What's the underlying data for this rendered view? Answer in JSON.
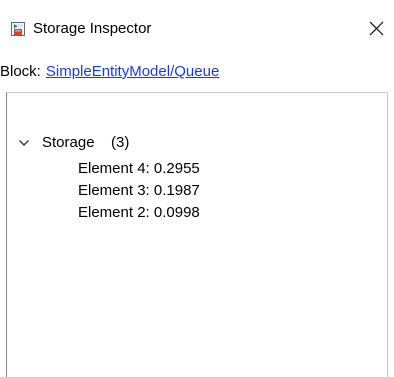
{
  "window": {
    "title": "Storage Inspector",
    "icon": "storage-inspector-app-icon",
    "close_icon": "close-icon"
  },
  "block": {
    "label": "Block:",
    "path": "SimpleEntityModel/Queue"
  },
  "tree": {
    "storage": {
      "label": "Storage",
      "count": "(3)",
      "expanded": true,
      "icon": "chevron-down-icon",
      "elements": [
        {
          "text": "Element 4: 0.2955"
        },
        {
          "text": "Element 3: 0.1987"
        },
        {
          "text": "Element 2: 0.0998"
        }
      ]
    }
  },
  "colors": {
    "link": "#1a3fd0",
    "background": "#ffffff",
    "icon_red": "#d4451f",
    "icon_blue": "#2a64c8"
  }
}
